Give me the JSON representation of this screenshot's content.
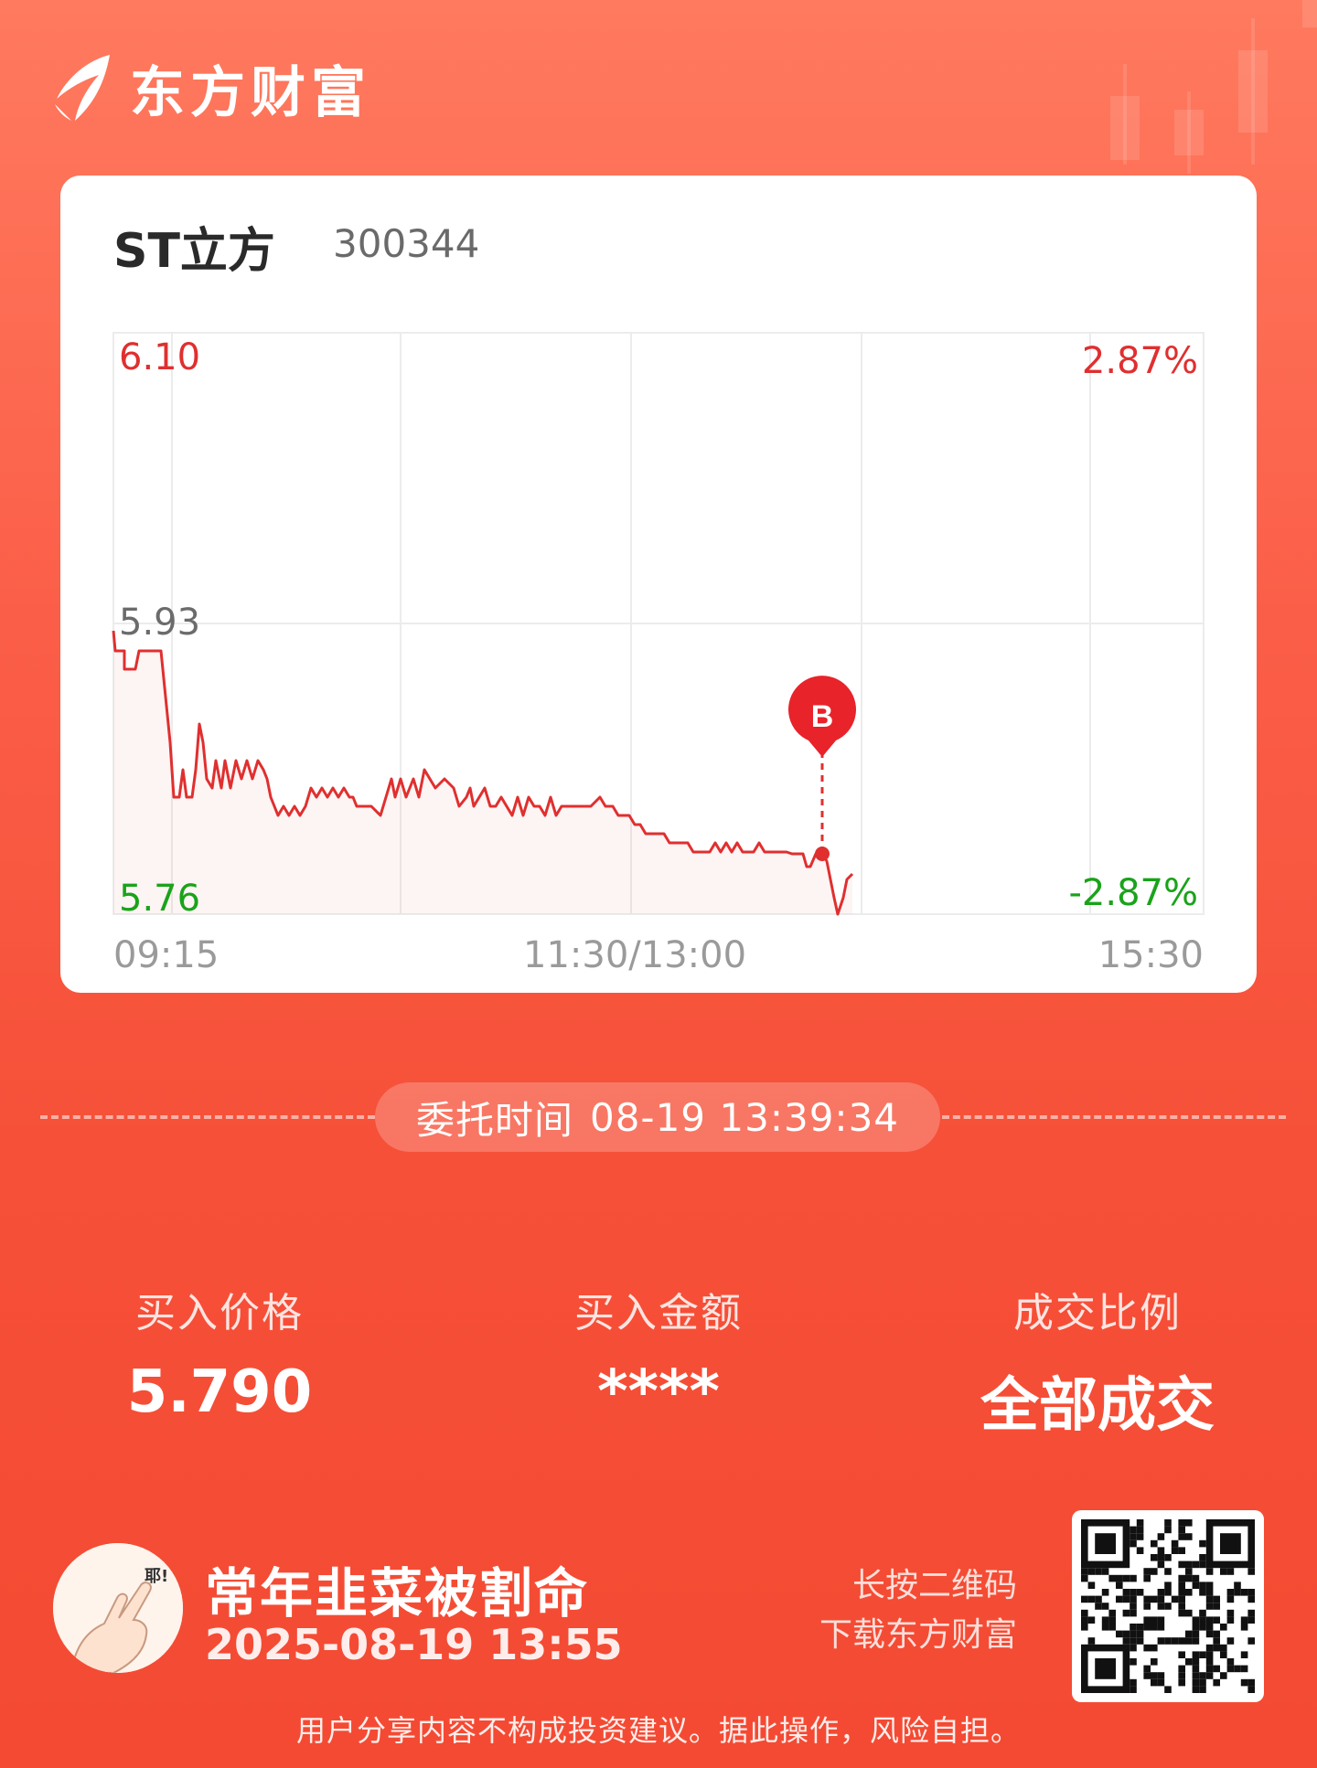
{
  "brand": {
    "name": "东方财富"
  },
  "stock": {
    "name": "ST立方",
    "code": "300344"
  },
  "intraday_chart": {
    "price_high_label": "6.10",
    "price_mid_label": "5.93",
    "price_low_label": "5.76",
    "pct_high_label": "2.87%",
    "pct_low_label": "-2.87%",
    "time_start": "09:15",
    "time_mid": "11:30/13:00",
    "time_end": "15:30",
    "marker_label": "B",
    "colors": {
      "line": "#e02f2f",
      "up": "#e02f2f",
      "down": "#1aa31a",
      "grid": "#ececec"
    }
  },
  "order": {
    "label": "委托时间",
    "time": "08-19 13:39:34"
  },
  "stats": {
    "price_label": "买入价格",
    "price_value": "5.790",
    "amount_label": "买入金额",
    "amount_value": "****",
    "ratio_label": "成交比例",
    "ratio_value": "全部成交"
  },
  "user": {
    "name": "常年韭菜被割命",
    "time": "2025-08-19 13:55"
  },
  "qr": {
    "hint_line1": "长按二维码",
    "hint_line2": "下载东方财富"
  },
  "disclaimer": "用户分享内容不构成投资建议。据此操作，风险自担。"
}
